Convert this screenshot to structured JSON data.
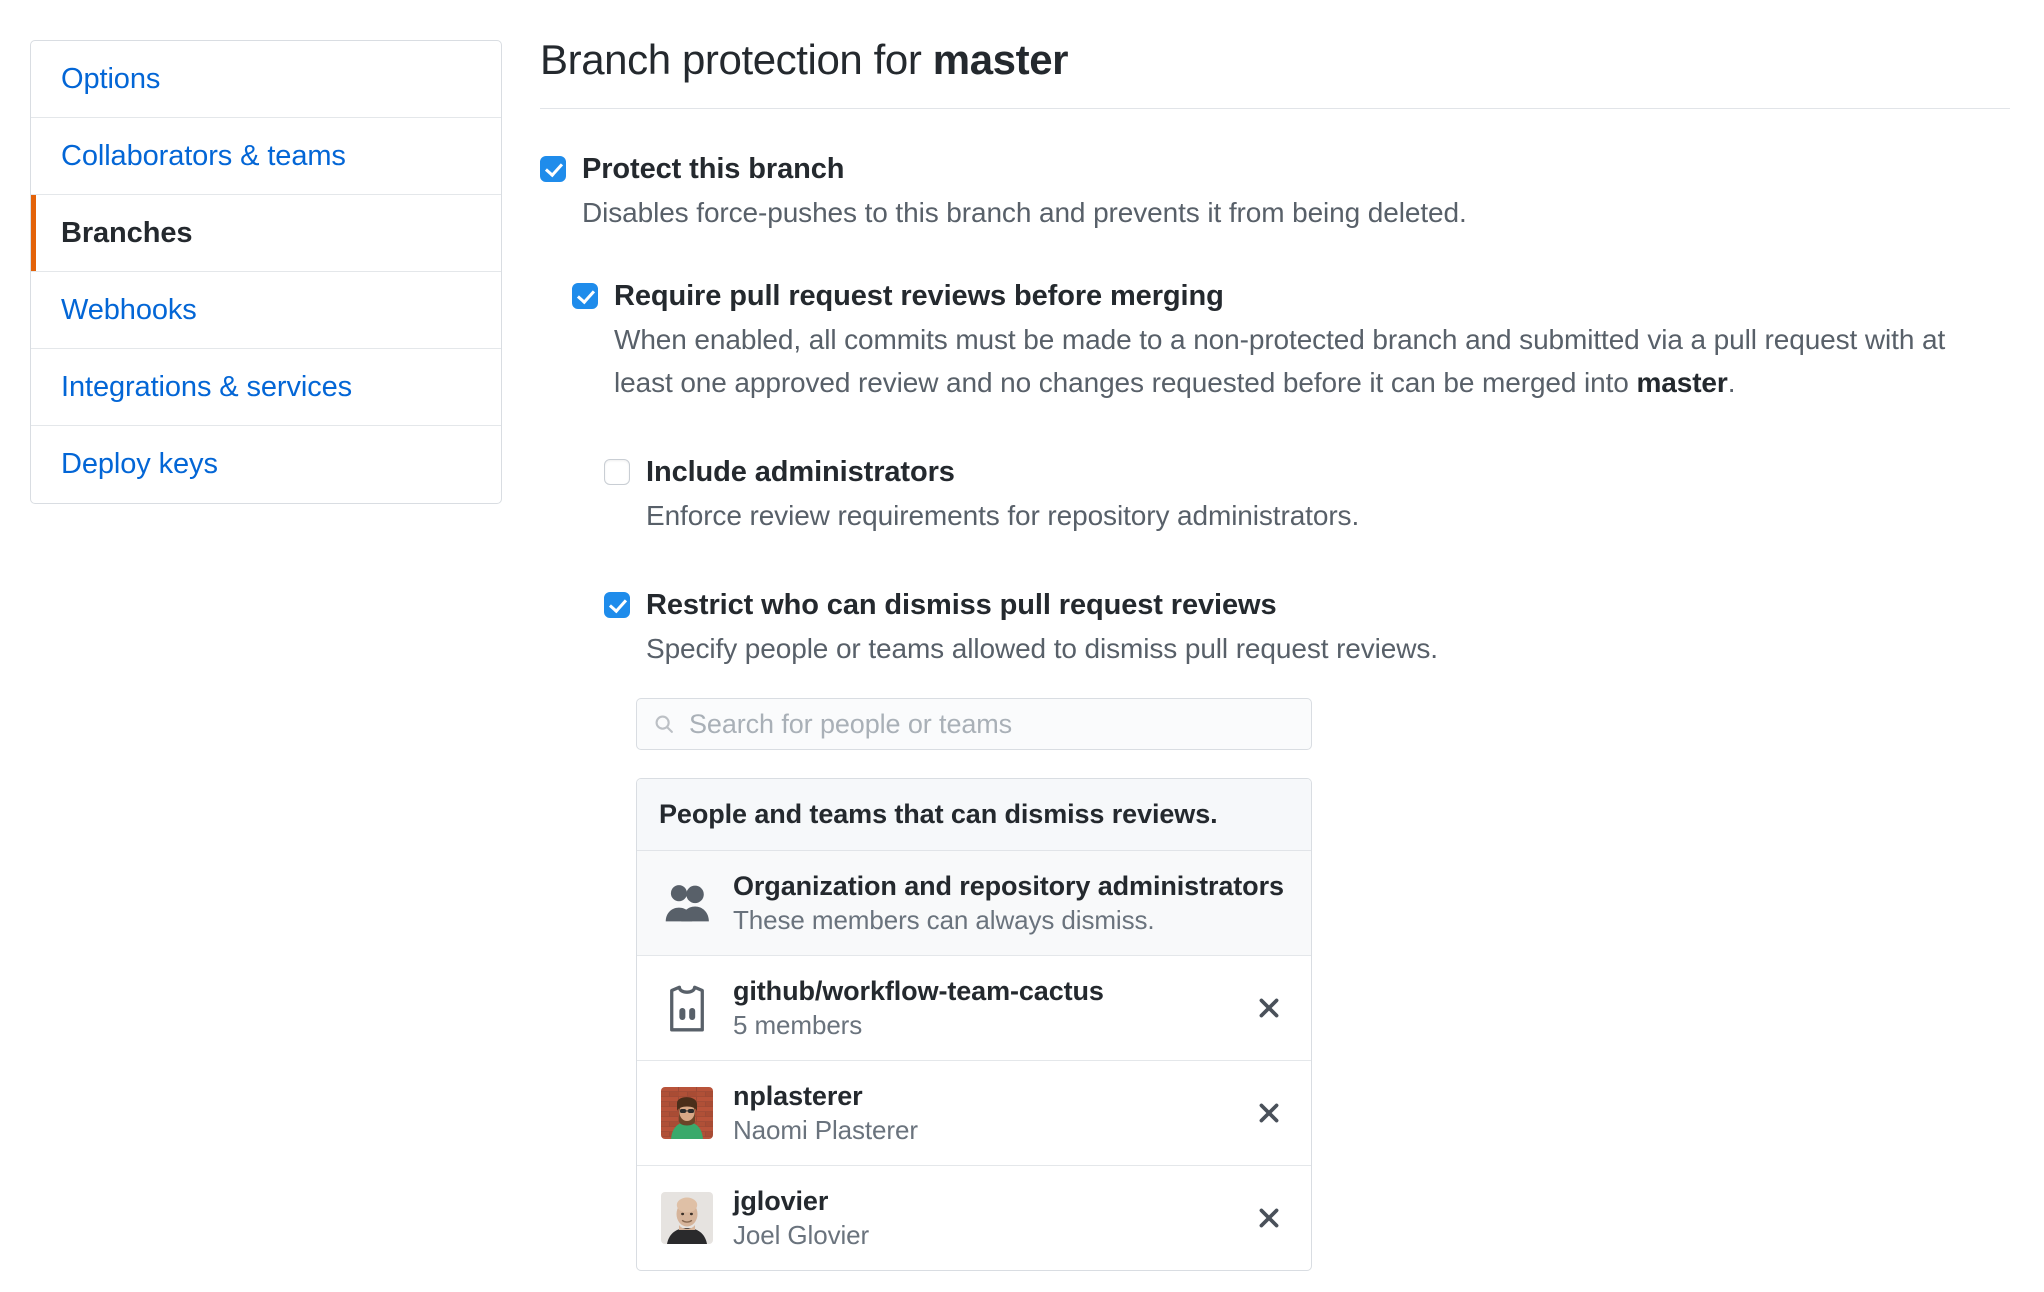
{
  "sidebar": {
    "items": [
      {
        "label": "Options",
        "selected": false
      },
      {
        "label": "Collaborators & teams",
        "selected": false
      },
      {
        "label": "Branches",
        "selected": true
      },
      {
        "label": "Webhooks",
        "selected": false
      },
      {
        "label": "Integrations & services",
        "selected": false
      },
      {
        "label": "Deploy keys",
        "selected": false
      }
    ]
  },
  "header": {
    "title_prefix": "Branch protection for ",
    "branch_name": "master"
  },
  "settings": {
    "protect_branch": {
      "label": "Protect this branch",
      "checked": true,
      "description": "Disables force-pushes to this branch and prevents it from being deleted."
    },
    "require_reviews": {
      "label": "Require pull request reviews before merging",
      "checked": true,
      "description_part1": "When enabled, all commits must be made to a non-protected branch and submitted via a pull request with at least one approved review and no changes requested before it can be merged into ",
      "description_bold": "master",
      "description_part2": "."
    },
    "include_admins": {
      "label": "Include administrators",
      "checked": false,
      "description": "Enforce review requirements for repository administrators."
    },
    "restrict_dismiss": {
      "label": "Restrict who can dismiss pull request reviews",
      "checked": true,
      "description": "Specify people or teams allowed to dismiss pull request reviews."
    }
  },
  "search": {
    "placeholder": "Search for people or teams",
    "value": "",
    "icon": "search-icon"
  },
  "dismiss_list": {
    "header": "People and teams that can dismiss reviews.",
    "rows": [
      {
        "kind": "organization",
        "icon": "people-icon",
        "title": "Organization and repository administrators",
        "subtitle": "These members can always dismiss.",
        "removable": false
      },
      {
        "kind": "team",
        "icon": "jersey-icon",
        "title": "github/workflow-team-cactus",
        "subtitle": "5 members",
        "removable": true,
        "remove_icon": "close-icon"
      },
      {
        "kind": "user",
        "icon": "avatar",
        "title": "nplasterer",
        "subtitle": "Naomi Plasterer",
        "removable": true,
        "remove_icon": "close-icon"
      },
      {
        "kind": "user",
        "icon": "avatar",
        "title": "jglovier",
        "subtitle": "Joel Glovier",
        "removable": true,
        "remove_icon": "close-icon"
      }
    ]
  },
  "colors": {
    "link": "#0366d6",
    "checkbox_on": "#1f8ceb",
    "accent_selected": "#e36209",
    "text": "#24292e",
    "muted_text": "#586069"
  }
}
